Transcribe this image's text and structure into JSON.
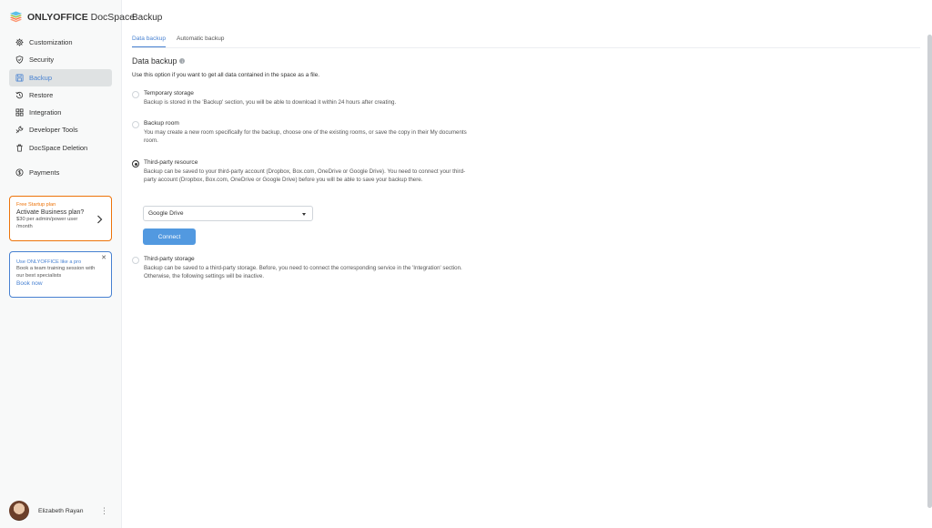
{
  "app": {
    "brand_bold": "ONLYOFFICE",
    "brand_light": " DocSpace"
  },
  "sidebar": {
    "items": [
      {
        "label": "Customization",
        "icon": "gear-icon"
      },
      {
        "label": "Security",
        "icon": "shield-icon"
      },
      {
        "label": "Backup",
        "icon": "floppy-icon",
        "active": true
      },
      {
        "label": "Restore",
        "icon": "restore-icon"
      },
      {
        "label": "Integration",
        "icon": "grid-icon"
      },
      {
        "label": "Developer Tools",
        "icon": "wrench-icon"
      },
      {
        "label": "DocSpace Deletion",
        "icon": "trash-icon"
      },
      {
        "label": "Payments",
        "icon": "coin-icon"
      }
    ]
  },
  "promo_business": {
    "title": "Free Startup plan",
    "headline": "Activate Business plan?",
    "body": "$30 per admin/power user /month"
  },
  "promo_training": {
    "title": "Use ONLYOFFICE like a pro",
    "body": "Book a team training session with our best specialists",
    "link": "Book now"
  },
  "user": {
    "name": "Elizabeth Rayan"
  },
  "main": {
    "title": "Backup",
    "tabs": [
      {
        "label": "Data backup",
        "active": true
      },
      {
        "label": "Automatic backup"
      }
    ],
    "section_title": "Data backup",
    "section_desc": "Use this option if you want to get all data contained in the space as a file.",
    "options": [
      {
        "label": "Temporary storage",
        "desc": "Backup is stored in the 'Backup' section, you will be able to download it within 24 hours after creating.",
        "checked": false
      },
      {
        "label": "Backup room",
        "desc": "You may create a new room specifically for the backup, choose one of the existing rooms, or save the copy in their My documents room.",
        "checked": false
      },
      {
        "label": "Third-party resource",
        "desc": "Backup can be saved to your third-party account (Dropbox, Box.com, OneDrive or Google Drive). You need to connect your third-party account (Dropbox, Box.com, OneDrive or Google Drive) before you will be able to save your backup there.",
        "checked": true
      },
      {
        "label": "Third-party storage",
        "desc": "Backup can be saved to a third-party storage. Before, you need to connect the corresponding service in the 'Integration' section. Otherwise, the following settings will be inactive.",
        "checked": false
      }
    ],
    "provider_select": {
      "value": "Google Drive"
    },
    "connect_label": "Connect"
  },
  "colors": {
    "accent": "#4781d1",
    "button": "#5299e0",
    "orange": "#ed7309"
  }
}
